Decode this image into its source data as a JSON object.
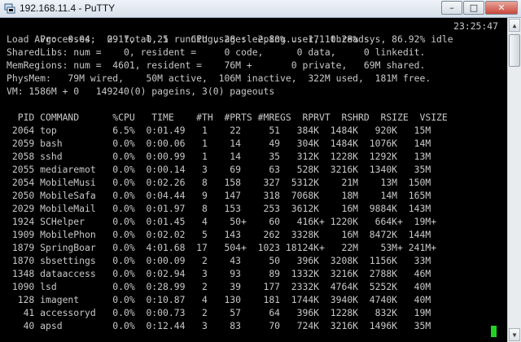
{
  "window": {
    "title": "192.168.11.4 - PuTTY",
    "minimize": "–",
    "maximize": "□",
    "close": "✕"
  },
  "icons": {
    "app": "putty-icon",
    "up": "▲",
    "down": "▼"
  },
  "colors": {
    "text": "#c8c8c8",
    "cursor": "#22d222",
    "background": "#000000"
  },
  "header": {
    "processes": "Processes:  29 total, 1 running, 28 sleeping... 171 threads",
    "time": "23:25:47",
    "load": "Load Avg:  0.04,  0.17,  0.25    CPU usage:  2.80% user, 10.28% sys, 86.92% idle",
    "sharedlibs": "SharedLibs: num =    0, resident =     0 code,      0 data,     0 linkedit.",
    "memregions": "MemRegions: num =  4601, resident =    76M +       0 private,   69M shared.",
    "physmem": "PhysMem:   79M wired,    50M active,  106M inactive,  322M used,  181M free.",
    "vm": "VM: 1586M + 0   149240(0) pageins, 3(0) pageouts"
  },
  "table": {
    "header": "  PID COMMAND      %CPU   TIME    #TH  #PRTS #MREGS  RPRVT  RSHRD  RSIZE  VSIZE",
    "rows": [
      " 2064 top          6.5%  0:01.49   1    22     51   384K  1484K   920K   15M",
      " 2059 bash         0.0%  0:00.06   1    14     49   304K  1484K  1076K   14M",
      " 2058 sshd         0.0%  0:00.99   1    14     35   312K  1228K  1292K   13M",
      " 2055 mediaremot   0.0%  0:00.14   3    69     63   528K  3216K  1340K   35M",
      " 2054 MobileMusi   0.0%  0:02.26   8   158    327  5312K    21M    13M  150M",
      " 2050 MobileSafa   0.0%  0:04.44   9   147    318  7068K    18M    14M  165M",
      " 2029 MobileMail   0.0%  0:01.97   8   153    253  3612K    16M  9884K  143M",
      " 1924 SCHelper     0.0%  0:01.45   4    50+    60   416K+ 1220K   664K+  19M+",
      " 1909 MobilePhon   0.0%  0:02.02   5   143    262  3328K    16M  8472K  144M",
      " 1879 SpringBoar   0.0%  4:01.68  17   504+  1023 18124K+   22M    53M+ 241M+",
      " 1870 sbsettings   0.0%  0:00.09   2    43     50   396K  3208K  1156K   33M",
      " 1348 dataaccess   0.0%  0:02.94   3    93     89  1332K  3216K  2788K   46M",
      " 1090 lsd          0.0%  0:28.99   2    39    177  2332K  4764K  5252K   40M",
      "  128 imagent      0.0%  0:10.87   4   130    181  1744K  3940K  4740K   40M",
      "   41 accessoryd   0.0%  0:00.73   2    57     64   396K  1228K   832K   19M",
      "   40 apsd         0.0%  0:12.44   3    83     70   724K  3216K  1496K   35M"
    ]
  }
}
